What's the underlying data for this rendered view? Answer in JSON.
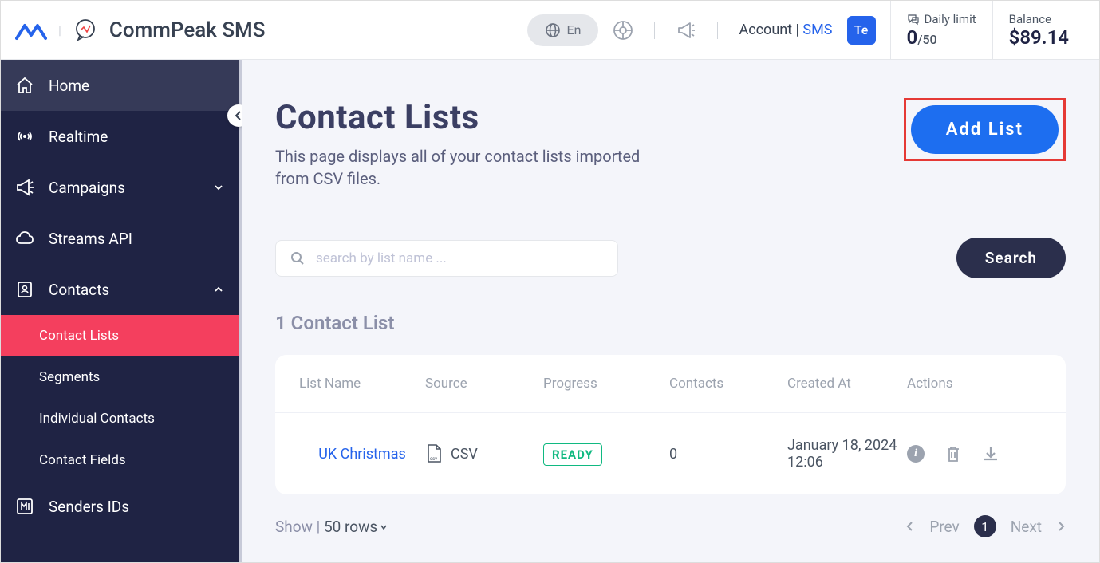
{
  "header": {
    "app_title": "CommPeak SMS",
    "lang": "En",
    "account_label": "Account | ",
    "sms_label": "SMS",
    "avatar": "Te",
    "daily_limit_label": "Daily limit",
    "daily_limit_value": "0",
    "daily_limit_total": "/50",
    "balance_label": "Balance",
    "balance_value": "$89.14"
  },
  "sidebar": {
    "home": "Home",
    "realtime": "Realtime",
    "campaigns": "Campaigns",
    "streams": "Streams API",
    "contacts": "Contacts",
    "contact_lists": "Contact Lists",
    "segments": "Segments",
    "individual": "Individual Contacts",
    "contact_fields": "Contact Fields",
    "senders": "Senders IDs"
  },
  "page": {
    "title": "Contact Lists",
    "desc": "This page displays all of your contact lists imported from CSV files.",
    "add_btn": "Add List",
    "search_placeholder": "search by list name ...",
    "search_btn": "Search",
    "list_count": "1 Contact List"
  },
  "table": {
    "headers": {
      "name": "List Name",
      "source": "Source",
      "progress": "Progress",
      "contacts": "Contacts",
      "created": "Created At",
      "actions": "Actions"
    },
    "row": {
      "name": "UK Christmas",
      "source": "CSV",
      "progress": "READY",
      "contacts": "0",
      "created": "January 18, 2024 12:06"
    }
  },
  "pagination": {
    "show": "Show | ",
    "rows": "50 rows",
    "prev": "Prev",
    "page": "1",
    "next": "Next"
  }
}
